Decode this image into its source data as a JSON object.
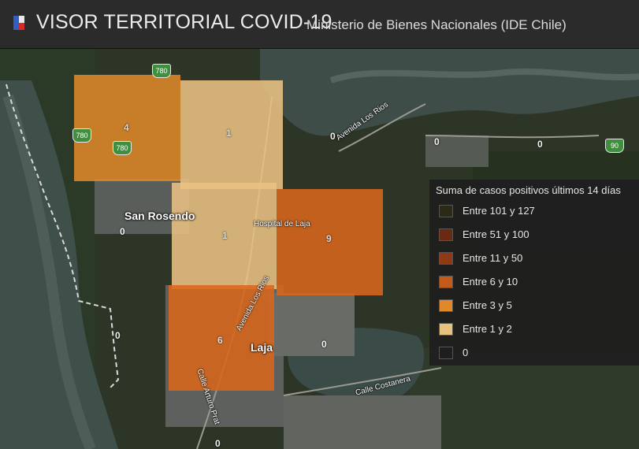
{
  "header": {
    "title": "VISOR TERRITORIAL COVID-19",
    "subtitle": "Ministerio de Bienes Nacionales (IDE Chile)"
  },
  "map": {
    "cells": [
      {
        "value": "4",
        "color": "#e48a2a"
      },
      {
        "value": "1",
        "color": "#e9c283"
      },
      {
        "value": "9",
        "color": "#d9661c"
      },
      {
        "value": "1",
        "color": "#e9c283"
      },
      {
        "value": "6",
        "color": "#d9661c"
      }
    ],
    "places": {
      "san_rosendo": "San Rosendo",
      "laja": "Laja",
      "hospital": "Hospital de Laja",
      "avenida_los_rios_1": "Avenida Los Rios",
      "avenida_los_rios_2": "Avenida Los Rios",
      "calle_arturo_prat": "Calle Arturo Prat",
      "calle_costanera": "Calle Costanera"
    },
    "zero_labels": [
      "0",
      "0",
      "0",
      "0",
      "0",
      "0",
      "0"
    ],
    "route_shields": [
      "780",
      "780",
      "780",
      "90"
    ]
  },
  "legend": {
    "title": "Suma de casos positivos últimos 14 días",
    "items": [
      {
        "label": "Entre 101 y 127",
        "color": "#2b2a16"
      },
      {
        "label": "Entre 51 y 100",
        "color": "#6a2a12"
      },
      {
        "label": "Entre 11 y 50",
        "color": "#8e3a14"
      },
      {
        "label": "Entre 6 y 10",
        "color": "#c45a1a"
      },
      {
        "label": "Entre 3 y 5",
        "color": "#e0882a"
      },
      {
        "label": "Entre 1 y 2",
        "color": "#e7c27e"
      },
      {
        "label": "0",
        "color": "#1e1e1e"
      }
    ]
  }
}
